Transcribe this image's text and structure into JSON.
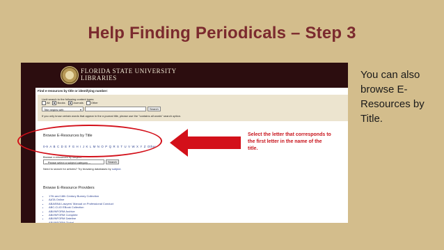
{
  "slide": {
    "title": "Help Finding Periodicals – Step 3",
    "side_note": "You can also browse E-Resources by Title."
  },
  "header": {
    "org_line1": "FLORIDA STATE UNIVERSITY",
    "org_line2": "LIBRARIES",
    "seal_icon": "university-seal-icon"
  },
  "search": {
    "heading": "Find e-resources by title or identifying number:",
    "limit_text": "Limit search to the following content types:",
    "types": [
      {
        "label": "All",
        "checked": false
      },
      {
        "label": "Books",
        "checked": true
      },
      {
        "label": "Journals",
        "checked": true
      },
      {
        "label": "Other",
        "checked": false
      }
    ],
    "mode": "Title begins with",
    "query": "",
    "search_button": "Search",
    "hint": "If you only know certain words that appear in the e-journal title, please use the \"contains all words\" search option."
  },
  "browse": {
    "title": "Browse E-Resources by Title",
    "letters": [
      "0-9",
      "A",
      "B",
      "C",
      "D",
      "E",
      "F",
      "G",
      "H",
      "I",
      "J",
      "K",
      "L",
      "M",
      "N",
      "O",
      "P",
      "Q",
      "R",
      "S",
      "T",
      "U",
      "V",
      "W",
      "X",
      "Y",
      "Z",
      "Other"
    ],
    "subject_label": "Browse e-resources by subject",
    "subject_select": "-- Please select a subject category --",
    "subject_button": "Search",
    "articles_text": "Need to search for articles? Try browsing databases by",
    "articles_link": "subject."
  },
  "providers": {
    "title": "Browse E-Resource Providers",
    "items": [
      "17th and 18th Century Burney Collection",
      "AATA Online",
      "ABA/BNA Lawyers' Manual on Professional Conduct",
      "ABC-CLIO EBook Collection",
      "ABI/INFORM Archive",
      "ABI/INFORM Complete",
      "ABI/INFORM Dateline",
      "ABI/INFORM Global"
    ]
  },
  "annotation": {
    "callout": "Select the letter that corresponds to the first letter in the name of the title.",
    "color": "#d3101a"
  }
}
